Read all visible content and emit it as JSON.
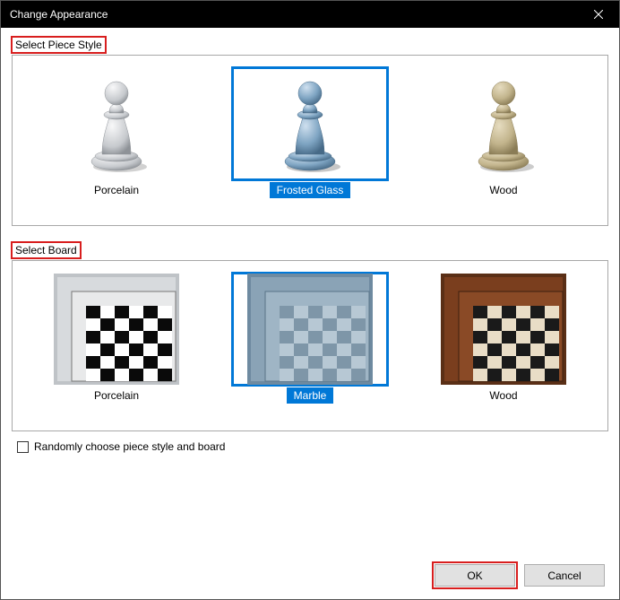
{
  "title": "Change Appearance",
  "piece_section": {
    "label": "Select Piece Style",
    "options": [
      {
        "id": "porcelain",
        "label": "Porcelain",
        "selected": false
      },
      {
        "id": "frosted_glass",
        "label": "Frosted Glass",
        "selected": true
      },
      {
        "id": "wood",
        "label": "Wood",
        "selected": false
      }
    ]
  },
  "board_section": {
    "label": "Select Board",
    "options": [
      {
        "id": "porcelain",
        "label": "Porcelain",
        "selected": false
      },
      {
        "id": "marble",
        "label": "Marble",
        "selected": true
      },
      {
        "id": "wood",
        "label": "Wood",
        "selected": false
      }
    ]
  },
  "random_checkbox": {
    "label": "Randomly choose piece style and board",
    "checked": false
  },
  "buttons": {
    "ok": "OK",
    "cancel": "Cancel"
  },
  "colors": {
    "selection": "#0078d7",
    "highlight_box": "#d81e1e"
  }
}
